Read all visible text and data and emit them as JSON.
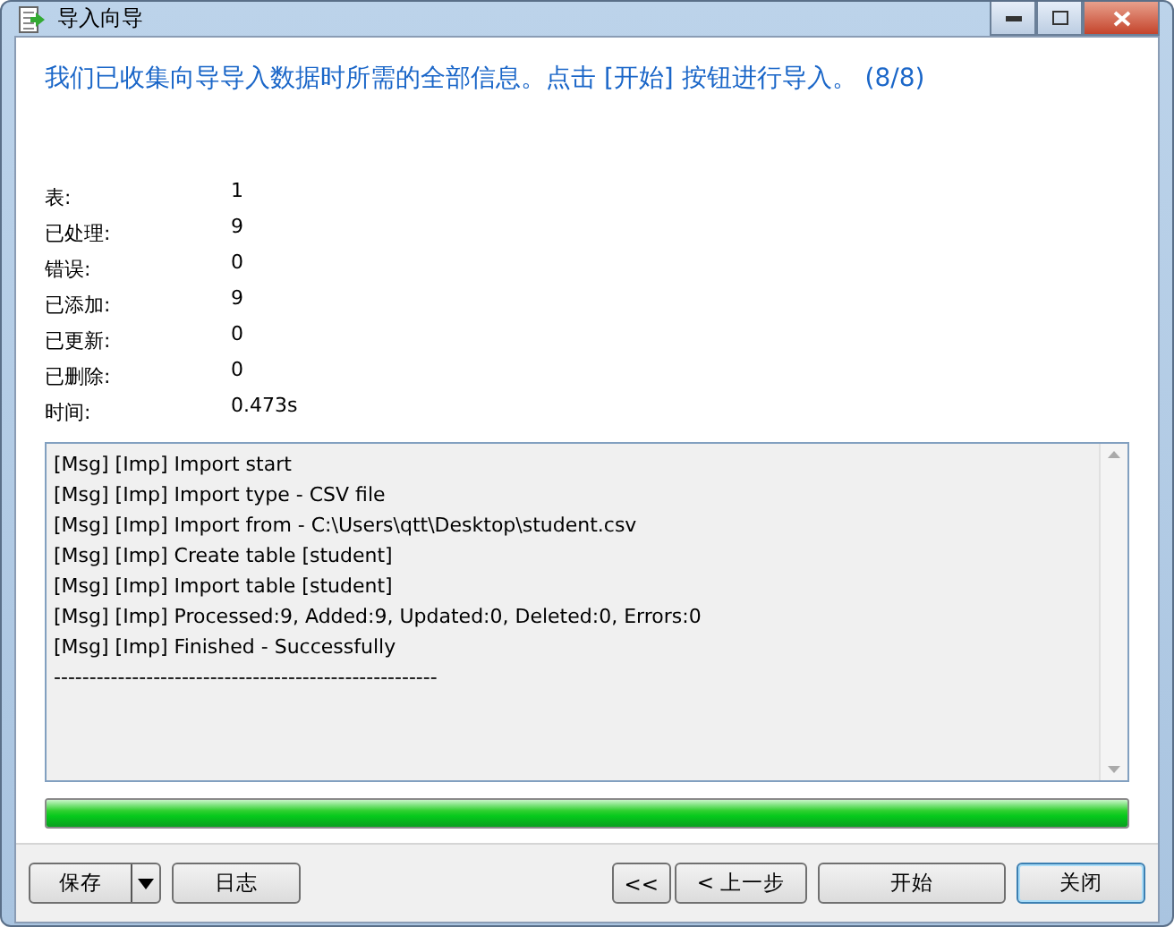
{
  "window": {
    "title": "导入向导"
  },
  "heading": "我们已收集向导导入数据时所需的全部信息。点击 [开始] 按钮进行导入。 (8/8)",
  "stats": [
    {
      "label": "表:",
      "value": "1"
    },
    {
      "label": "已处理:",
      "value": "9"
    },
    {
      "label": "错误:",
      "value": "0"
    },
    {
      "label": "已添加:",
      "value": "9"
    },
    {
      "label": "已更新:",
      "value": "0"
    },
    {
      "label": "已删除:",
      "value": "0"
    },
    {
      "label": "时间:",
      "value": "0.473s"
    }
  ],
  "log": [
    "[Msg] [Imp] Import start",
    "[Msg] [Imp] Import type - CSV file",
    "[Msg] [Imp] Import from - C:\\Users\\qtt\\Desktop\\student.csv",
    "[Msg] [Imp] Create table [student]",
    "[Msg] [Imp] Import table [student]",
    "[Msg] [Imp] Processed:9, Added:9, Updated:0, Deleted:0, Errors:0",
    "[Msg] [Imp] Finished - Successfully",
    "------------------------------------------------------"
  ],
  "progress": {
    "level": 1
  },
  "footer": {
    "save": "保存",
    "log": "日志",
    "first": "<<",
    "back": "< 上一步",
    "start": "开始",
    "close": "关闭"
  }
}
